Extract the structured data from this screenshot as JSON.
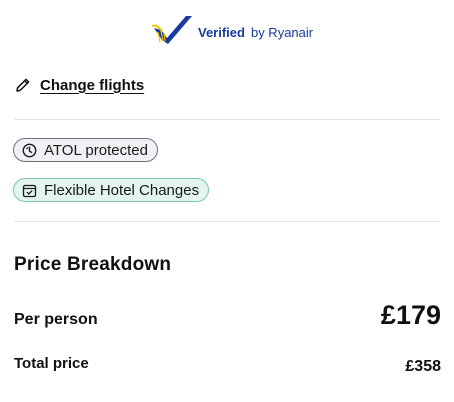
{
  "verified": {
    "strong_text": "Verified",
    "by_text": "by Ryanair",
    "brand_color": "#1a3a9e",
    "logo_icon": "ryanair-harp-check-icon"
  },
  "change_flights": {
    "icon": "pencil-icon",
    "label": "Change flights"
  },
  "badges": [
    {
      "icon": "atol-icon",
      "label": "ATOL protected",
      "color": "#f1f1f5"
    },
    {
      "icon": "calendar-check-icon",
      "label": "Flexible Hotel Changes",
      "color": "#e3f5ec"
    }
  ],
  "price_breakdown": {
    "title": "Price Breakdown",
    "per_person_label": "Per person",
    "per_person_value": "£179",
    "total_label": "Total price",
    "total_value": "£358"
  }
}
